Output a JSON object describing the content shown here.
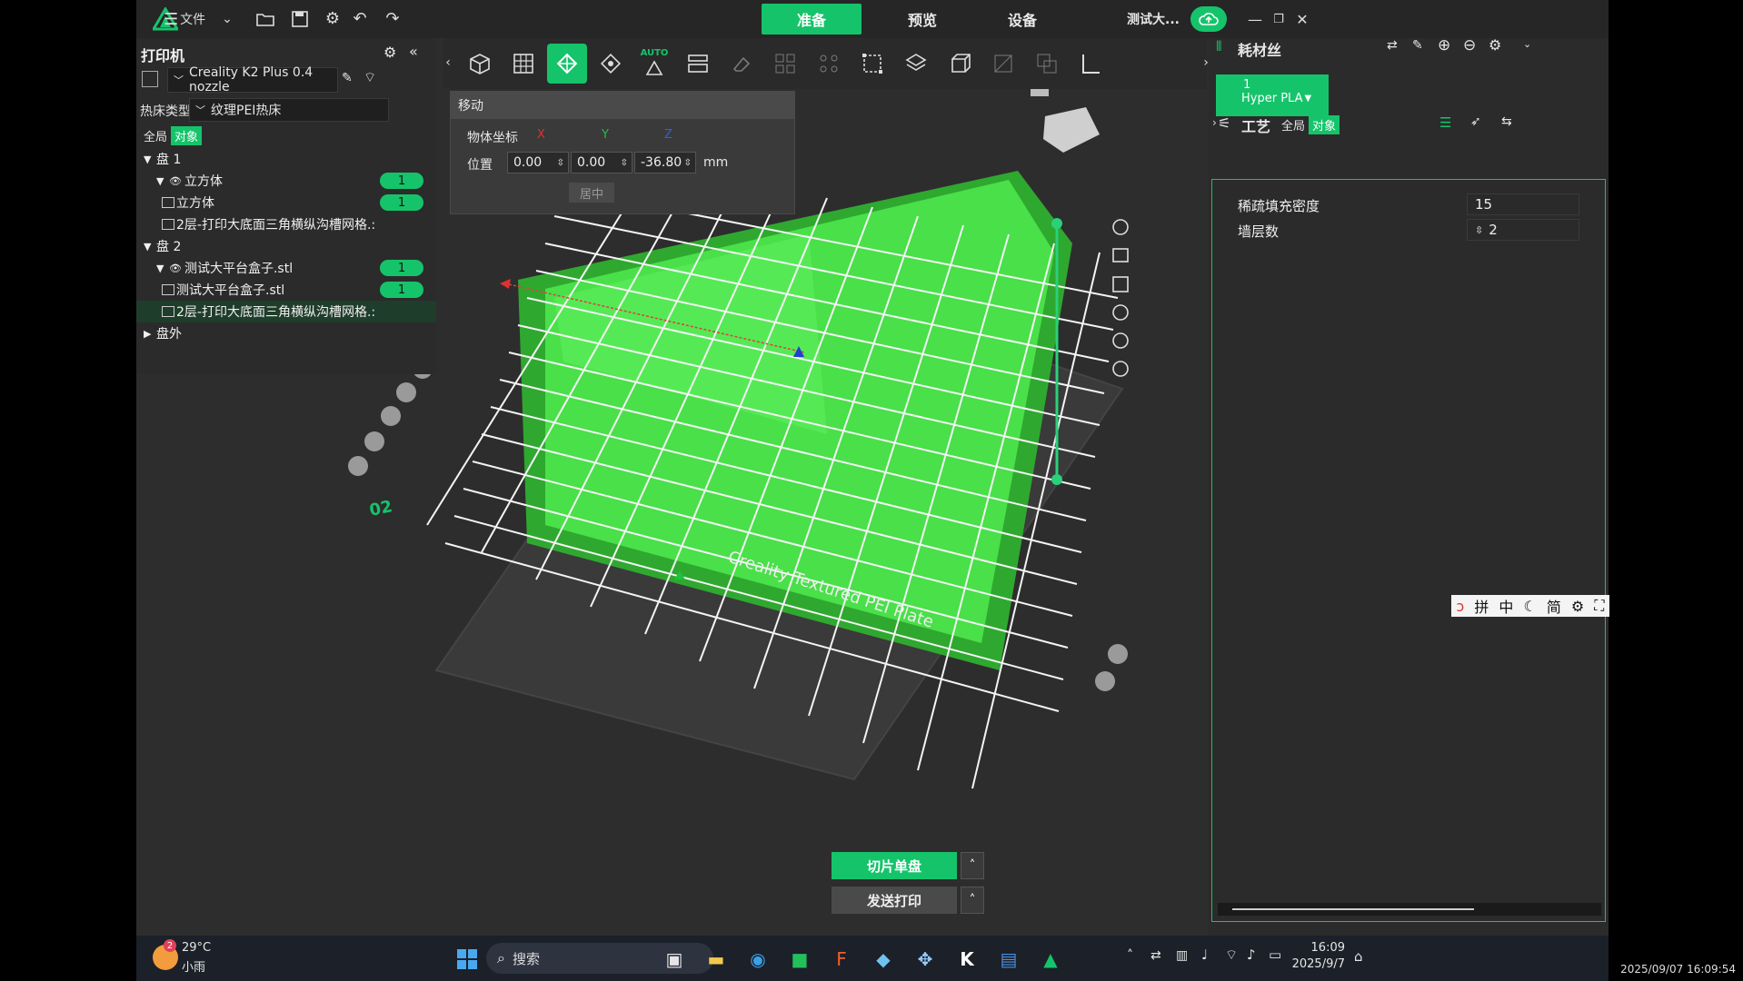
{
  "app": {
    "top_tabs": [
      {
        "label": "准备",
        "active": true
      },
      {
        "label": "预览",
        "active": false
      },
      {
        "label": "设备",
        "active": false
      }
    ],
    "file_menu_label": "文件",
    "project_name": "测试大...",
    "accent_color": "#15c46a"
  },
  "printer_panel": {
    "title": "打印机",
    "printer_name": "Creality K2 Plus 0.4 nozzle",
    "bed_type_label": "热床类型",
    "bed_type_value": "纹理PEI热床",
    "scope_global": "全局",
    "scope_object": "对象"
  },
  "object_tree": {
    "rows": [
      {
        "text": "盘 1",
        "level": 0,
        "expander": "▼",
        "badge": ""
      },
      {
        "text": "立方体",
        "level": 1,
        "expander": "▼",
        "badge": "1"
      },
      {
        "text": "立方体",
        "level": 2,
        "expander": "",
        "badge": "1"
      },
      {
        "text": "2层-打印大底面三角横纵沟槽网格.:",
        "level": 2,
        "expander": "",
        "badge": ""
      },
      {
        "text": "盘 2",
        "level": 0,
        "expander": "▼",
        "badge": ""
      },
      {
        "text": "测试大平台盒子.stl",
        "level": 1,
        "expander": "▼",
        "badge": "1"
      },
      {
        "text": "测试大平台盒子.stl",
        "level": 2,
        "expander": "",
        "badge": "1"
      },
      {
        "text": "2层-打印大底面三角横纵沟槽网格.:",
        "level": 2,
        "expander": "",
        "badge": "",
        "selected": true
      },
      {
        "text": "盘外",
        "level": 0,
        "expander": "▶",
        "badge": ""
      }
    ]
  },
  "move_panel": {
    "title": "移动",
    "coord_label": "物体坐标",
    "axis_x": "X",
    "axis_y": "Y",
    "axis_z": "Z",
    "position_label": "位置",
    "x": "0.00",
    "y": "0.00",
    "z": "-36.80",
    "unit": "mm",
    "center_btn": "居中"
  },
  "filament_panel": {
    "title": "耗材丝",
    "slot_number": "1",
    "slot_name": "Hyper PLA"
  },
  "process_panel": {
    "title": "工艺",
    "scope_global": "全局",
    "scope_object": "对象",
    "settings": [
      {
        "label": "稀疏填充密度",
        "value": "15"
      },
      {
        "label": "墙层数",
        "value": "2"
      }
    ]
  },
  "actions": {
    "slice_label": "切片单盘",
    "print_label": "发送打印",
    "auto_label": "AUTO",
    "bed_text": "Creality Textured PEI Plate",
    "plate_number": "02"
  },
  "ime_bar": [
    "拼",
    "中",
    "简"
  ],
  "taskbar": {
    "weather_temp": "29°C",
    "weather_desc": "小雨",
    "weather_badge": "2",
    "search_placeholder": "搜索",
    "time": "16:09",
    "date": "2025/9/7"
  },
  "timestamp_overlay": "2025/09/07 16:09:54"
}
